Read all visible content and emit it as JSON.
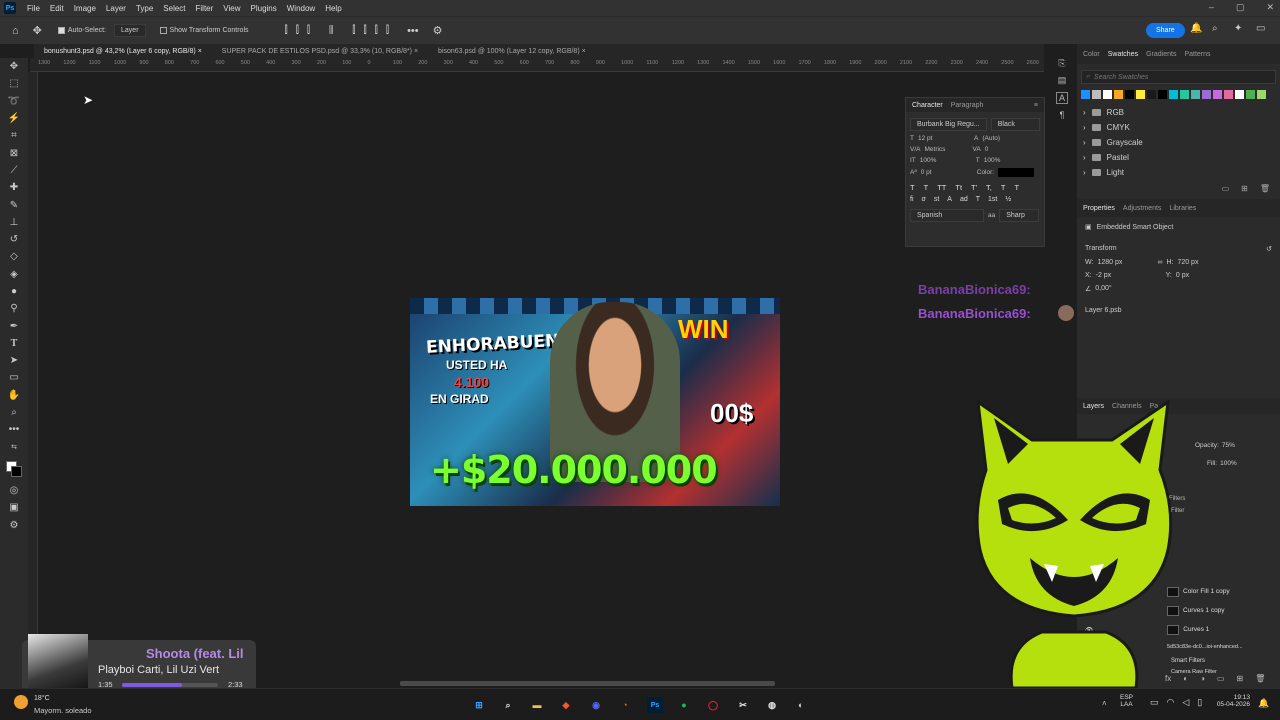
{
  "menubar": {
    "items": [
      "File",
      "Edit",
      "Image",
      "Layer",
      "Type",
      "Select",
      "Filter",
      "View",
      "Plugins",
      "Window",
      "Help"
    ]
  },
  "options": {
    "auto_select_label": "Auto-Select:",
    "auto_select_value": "Layer",
    "transform_controls_label": "Show Transform Controls",
    "share_label": "Share"
  },
  "tabs": [
    {
      "label": "bonushunt3.psd @ 43,2% (Layer 6 copy, RGB/8)",
      "active": true
    },
    {
      "label": "SUPER PACK DE ESTILOS PSD.psd @ 33,3% (10, RGB/8*)",
      "active": false
    },
    {
      "label": "bison63.psd @ 100% (Layer 12 copy, RGB/8)",
      "active": false
    }
  ],
  "ruler_labels": [
    "1300",
    "1200",
    "1100",
    "1000",
    "900",
    "800",
    "700",
    "600",
    "500",
    "400",
    "300",
    "200",
    "100",
    "0",
    "100",
    "200",
    "300",
    "400",
    "500",
    "600",
    "700",
    "800",
    "900",
    "1000",
    "1100",
    "1200",
    "1300",
    "1400",
    "1500",
    "1600",
    "1700",
    "1800",
    "1900",
    "2000",
    "2100",
    "2200",
    "2300",
    "2400",
    "2500",
    "2600"
  ],
  "thumbnail": {
    "headline": "ENHORABUENA",
    "subtext_1": "USTED HA",
    "subtext_2": "4.100",
    "subtext_3": "EN GIRAD",
    "right_text": "WIN",
    "right_num": "00$",
    "amount": "+$20.000.000"
  },
  "character_panel": {
    "tabs": [
      "Character",
      "Paragraph"
    ],
    "font_family": "Burbank Big Regu...",
    "font_style": "Black",
    "font_size": "12 pt",
    "leading": "(Auto)",
    "kerning": "Metrics",
    "tracking": "0",
    "vscale": "100%",
    "hscale": "100%",
    "baseline": "0 pt",
    "color_label": "Color:",
    "language": "Spanish",
    "aa": "Sharp",
    "style_buttons": [
      "T",
      "T",
      "TT",
      "Tt",
      "T'",
      "T,",
      "T",
      "T"
    ],
    "ot_buttons": [
      "fi",
      "σ",
      "st",
      "A",
      "ad",
      "T",
      "1st",
      "½"
    ]
  },
  "swatches": {
    "tabs": [
      "Color",
      "Swatches",
      "Gradients",
      "Patterns"
    ],
    "search_placeholder": "Search Swatches",
    "colors": [
      "#1f8fff",
      "#bdbdbd",
      "#ffffff",
      "#f9a825",
      "#000000",
      "#ffeb3b",
      "#1a1a1a",
      "#000000",
      "#00bcd4",
      "#26c6a0",
      "#4db6ac",
      "#9c6bd4",
      "#c46be0",
      "#e06b9c",
      "#ffffff",
      "#4caf50",
      "#9bd96b"
    ],
    "folders": [
      "RGB",
      "CMYK",
      "Grayscale",
      "Pastel",
      "Light"
    ]
  },
  "properties": {
    "tabs": [
      "Properties",
      "Adjustments",
      "Libraries"
    ],
    "type_label": "Embedded Smart Object",
    "transform_label": "Transform",
    "w_label": "W:",
    "w_value": "1280 px",
    "h_label": "H:",
    "h_value": "720 px",
    "x_label": "X:",
    "x_value": "-2 px",
    "y_label": "Y:",
    "y_value": "0 px",
    "angle_value": "0,00°",
    "file_label": "Layer 6.psb"
  },
  "layers": {
    "tabs": [
      "Layers",
      "Channels",
      "Pa"
    ],
    "opacity_label": "Opacity:",
    "opacity_value": "75%",
    "fill_label": "Fill:",
    "fill_value": "100%",
    "row_filters": "Filters",
    "row_filter": "Filter",
    "rows": [
      "Color Fill 1 copy",
      "Curves 1 copy",
      "Curves 1",
      "5d53c83e-dc0...ioi-enhanced...",
      "Smart Filters",
      "Camera Raw Filter"
    ]
  },
  "chat": {
    "name_1": "BananaBionica69:",
    "name_2": "BananaBionica69:"
  },
  "music": {
    "title": "Shoota (feat. Lil",
    "artist": "Playboi Carti, Lil Uzi Vert",
    "elapsed": "1:35",
    "total": "2:33",
    "progress": 0.62
  },
  "taskbar": {
    "weather_temp": "18°C",
    "weather_desc": "Mayorm. soleado",
    "lang": "ESP",
    "lang_sub": "LAA",
    "time": "19:13",
    "date": "05-04-2026"
  }
}
